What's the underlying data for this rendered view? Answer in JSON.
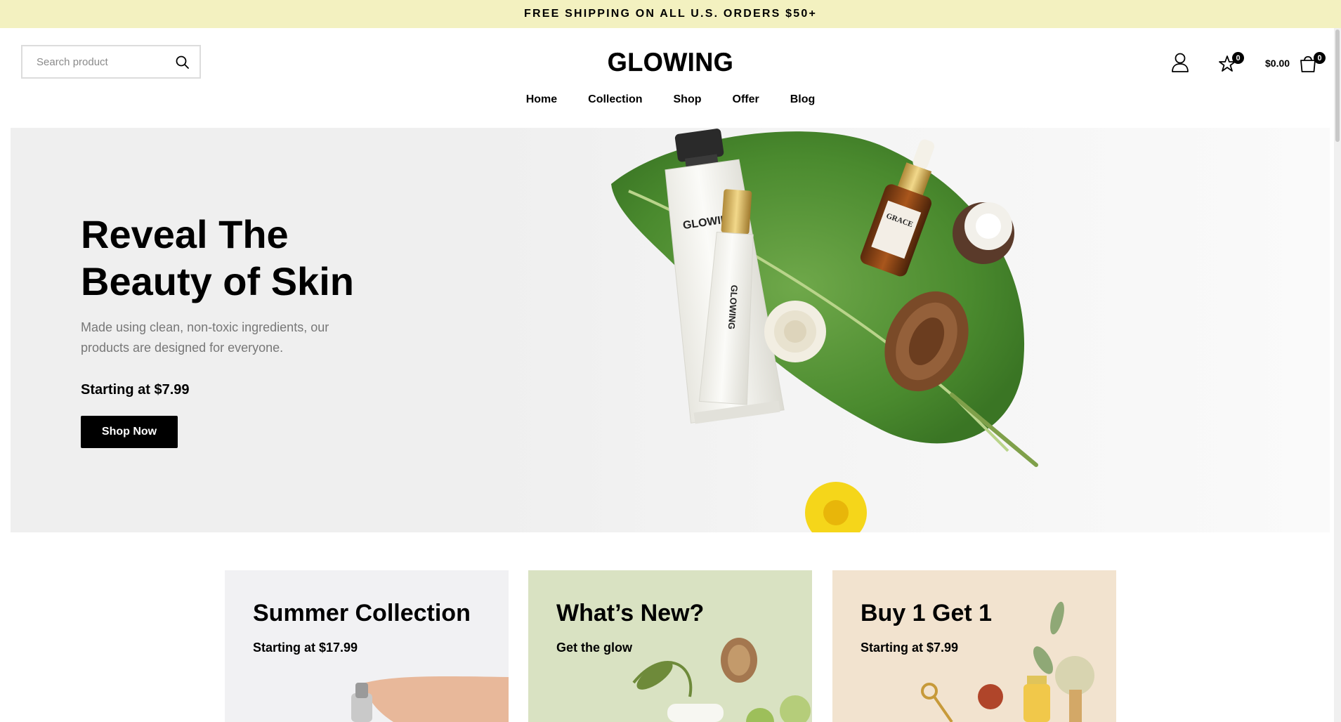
{
  "banner": {
    "text": "FREE SHIPPING ON ALL U.S. ORDERS $50+"
  },
  "header": {
    "search_placeholder": "Search product",
    "logo": "GLOWING",
    "wishlist_count": "0",
    "cart_total": "$0.00",
    "cart_count": "0"
  },
  "nav": {
    "items": [
      {
        "label": "Home"
      },
      {
        "label": "Collection"
      },
      {
        "label": "Shop"
      },
      {
        "label": "Offer"
      },
      {
        "label": "Blog"
      }
    ]
  },
  "hero": {
    "title_line1": "Reveal The",
    "title_line2": "Beauty of Skin",
    "description": "Made using clean, non-toxic ingredients, our products are designed for everyone.",
    "price": "Starting at $7.99",
    "button": "Shop Now",
    "tube_brand": "GLOWING",
    "small_tube_brand": "GLOWING",
    "serum_brand": "GRACE"
  },
  "cards": [
    {
      "title": "Summer Collection",
      "subtitle": "Starting at $17.99",
      "bg": "#f1f1f3"
    },
    {
      "title": "What’s New?",
      "subtitle": "Get the glow",
      "bg": "#d9e2c2"
    },
    {
      "title": "Buy 1 Get 1",
      "subtitle": "Starting at $7.99",
      "bg": "#f2e3cf"
    }
  ],
  "colors": {
    "banner_bg": "#f3f1c0",
    "hero_bg": "#efefef",
    "button_bg": "#000000"
  },
  "icons": [
    "search-icon",
    "user-icon",
    "star-icon",
    "shopping-bag-icon"
  ]
}
